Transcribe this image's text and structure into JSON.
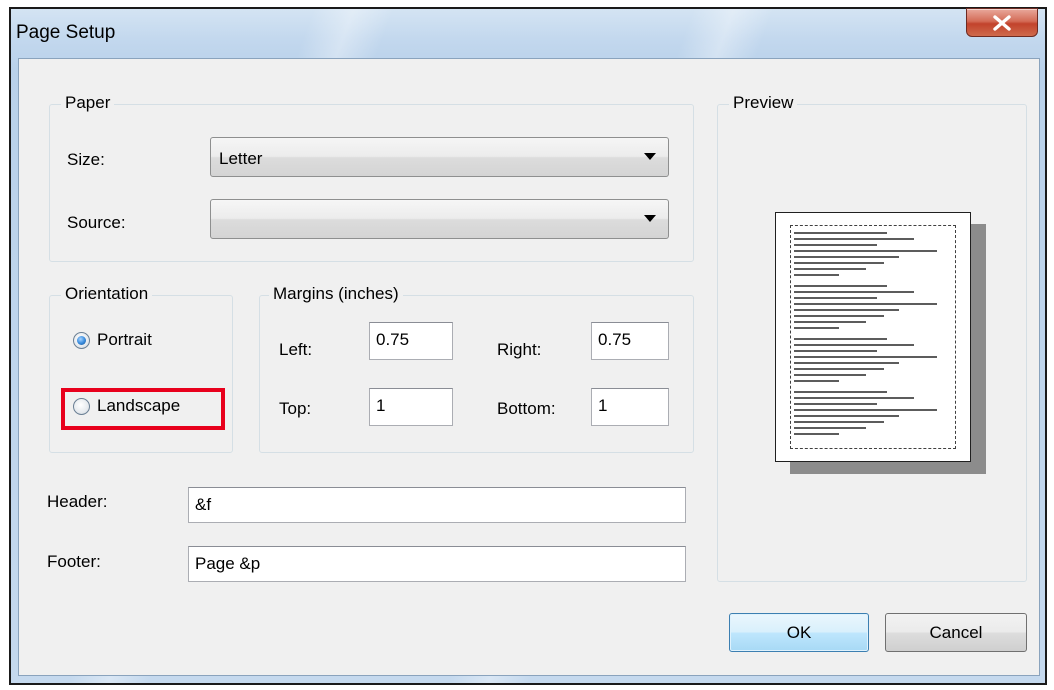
{
  "window": {
    "title": "Page Setup",
    "close_glyph": "X"
  },
  "paper": {
    "group_label": "Paper",
    "size_label": "Size:",
    "size_value": "Letter",
    "source_label": "Source:",
    "source_value": ""
  },
  "orientation": {
    "group_label": "Orientation",
    "portrait_label": "Portrait",
    "landscape_label": "Landscape",
    "selected": "Portrait"
  },
  "margins": {
    "group_label": "Margins (inches)",
    "left_label": "Left:",
    "left_value": "0.75",
    "right_label": "Right:",
    "right_value": "0.75",
    "top_label": "Top:",
    "top_value": "1",
    "bottom_label": "Bottom:",
    "bottom_value": "1"
  },
  "header": {
    "label": "Header:",
    "value": "&f"
  },
  "footer": {
    "label": "Footer:",
    "value": "Page &p"
  },
  "preview": {
    "group_label": "Preview"
  },
  "buttons": {
    "ok": "OK",
    "cancel": "Cancel"
  },
  "colors": {
    "highlight": "#e8001c",
    "radio_selected": "#3b8ee0",
    "ok_border": "#3c7fb1"
  },
  "icons": {
    "close": "close-icon",
    "dropdown": "chevron-down-icon"
  }
}
